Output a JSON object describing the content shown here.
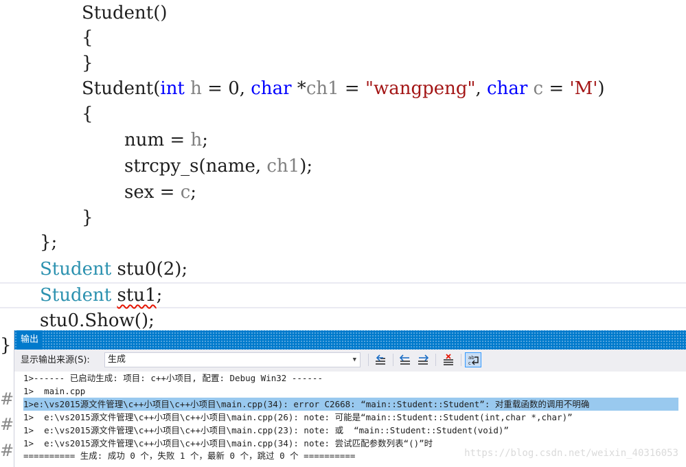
{
  "editor": {
    "lines": [
      {
        "tokens": [
          {
            "t": "Student()",
            "c": ""
          }
        ]
      },
      {
        "tokens": [
          {
            "t": "{",
            "c": ""
          }
        ]
      },
      {
        "tokens": [
          {
            "t": "}",
            "c": ""
          }
        ]
      },
      {
        "tokens": [
          {
            "t": "Student(",
            "c": ""
          },
          {
            "t": "int",
            "c": "kw"
          },
          {
            "t": " ",
            "c": ""
          },
          {
            "t": "h",
            "c": "pr"
          },
          {
            "t": " = 0, ",
            "c": ""
          },
          {
            "t": "char",
            "c": "kw"
          },
          {
            "t": " *",
            "c": ""
          },
          {
            "t": "ch1",
            "c": "pr"
          },
          {
            "t": " = ",
            "c": ""
          },
          {
            "t": "\"wangpeng\"",
            "c": "st"
          },
          {
            "t": ", ",
            "c": ""
          },
          {
            "t": "char",
            "c": "kw"
          },
          {
            "t": " ",
            "c": ""
          },
          {
            "t": "c",
            "c": "pr"
          },
          {
            "t": " = ",
            "c": ""
          },
          {
            "t": "'M'",
            "c": "st"
          },
          {
            "t": ")",
            "c": ""
          }
        ]
      },
      {
        "tokens": [
          {
            "t": "{",
            "c": ""
          }
        ]
      },
      {
        "tokens": [
          {
            "t": "num = ",
            "c": ""
          },
          {
            "t": "h",
            "c": "pr"
          },
          {
            "t": ";",
            "c": ""
          }
        ]
      },
      {
        "tokens": [
          {
            "t": "strcpy_s(name, ",
            "c": ""
          },
          {
            "t": "ch1",
            "c": "pr"
          },
          {
            "t": ");",
            "c": ""
          }
        ]
      },
      {
        "tokens": [
          {
            "t": "sex = ",
            "c": ""
          },
          {
            "t": "c",
            "c": "pr"
          },
          {
            "t": ";",
            "c": ""
          }
        ]
      },
      {
        "tokens": [
          {
            "t": "}",
            "c": ""
          }
        ]
      },
      {
        "tokens": [
          {
            "t": "};",
            "c": ""
          }
        ]
      },
      {
        "tokens": [
          {
            "t": "Student",
            "c": "ty"
          },
          {
            "t": " stu0(2);",
            "c": ""
          }
        ]
      },
      {
        "tokens": [
          {
            "t": "Student",
            "c": "ty"
          },
          {
            "t": " ",
            "c": ""
          },
          {
            "t": "stu1",
            "c": "squiggle"
          },
          {
            "t": ";",
            "c": ""
          }
        ]
      },
      {
        "tokens": [
          {
            "t": "stu0.Show();",
            "c": ""
          }
        ]
      }
    ],
    "outer_brace": "}",
    "gutter_fragments": [
      "#e",
      "#i",
      "#i"
    ]
  },
  "output": {
    "title": "输出",
    "source_label": "显示输出来源(S):",
    "source_value": "生成",
    "toolbar_icons": [
      "goto-selected-icon",
      "prev-message-icon",
      "next-message-icon",
      "clear-all-icon",
      "word-wrap-icon"
    ],
    "lines": [
      "1>------ 已启动生成: 项目: c++小项目, 配置: Debug Win32 ------",
      "1>  main.cpp",
      "1>e:\\vs2015源文件管理\\c++小项目\\c++小项目\\main.cpp(34): error C2668: “main::Student::Student”: 对重载函数的调用不明确",
      "1>  e:\\vs2015源文件管理\\c++小项目\\c++小项目\\main.cpp(26): note: 可能是“main::Student::Student(int,char *,char)”",
      "1>  e:\\vs2015源文件管理\\c++小项目\\c++小项目\\main.cpp(23): note: 或  “main::Student::Student(void)”",
      "1>  e:\\vs2015源文件管理\\c++小项目\\c++小项目\\main.cpp(34): note: 尝试匹配参数列表“()”时",
      "========== 生成: 成功 0 个，失败 1 个，最新 0 个，跳过 0 个 =========="
    ],
    "selected_line": 2,
    "watermark": "https://blog.csdn.net/weixin_40316053"
  },
  "colors": {
    "keyword": "#0000ff",
    "type": "#2b91af",
    "parameter": "#808080",
    "string": "#a31515",
    "titlebar": "#007acc",
    "selection": "#99c9ef",
    "squiggle": "#e51400"
  }
}
